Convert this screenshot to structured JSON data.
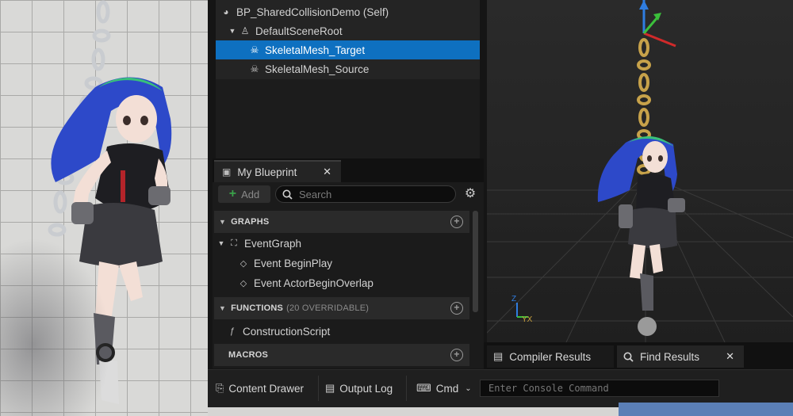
{
  "component_tree": {
    "root": "BP_SharedCollisionDemo (Self)",
    "scene_root": "DefaultSceneRoot",
    "items": [
      {
        "label": "SkeletalMesh_Target",
        "selected": true
      },
      {
        "label": "SkeletalMesh_Source",
        "selected": false
      }
    ]
  },
  "my_blueprint": {
    "tab_label": "My Blueprint",
    "add_label": "Add",
    "search_placeholder": "Search",
    "sections": {
      "graphs": "GRAPHS",
      "functions": "FUNCTIONS",
      "functions_sub": "(20 OVERRIDABLE)",
      "macros": "MACROS"
    },
    "graphs": {
      "event_graph": "EventGraph",
      "events": [
        "Event BeginPlay",
        "Event ActorBeginOverlap"
      ]
    },
    "functions": [
      "ConstructionScript"
    ]
  },
  "viewport": {
    "axis_label": "YX",
    "axis_z": "Z"
  },
  "dock_tabs": {
    "compiler_results": "Compiler Results",
    "find_results": "Find Results"
  },
  "status_bar": {
    "content_drawer": "Content Drawer",
    "output_log": "Output Log",
    "cmd": "Cmd",
    "console_placeholder": "Enter Console Command"
  },
  "colors": {
    "selection": "#0e70c0",
    "panel": "#242424",
    "add_green": "#3aa34a"
  },
  "icons": {
    "blueprint": "blueprint-icon",
    "skeletal_mesh": "skeletal-mesh-icon",
    "event": "event-diamond-icon",
    "function": "function-icon"
  }
}
